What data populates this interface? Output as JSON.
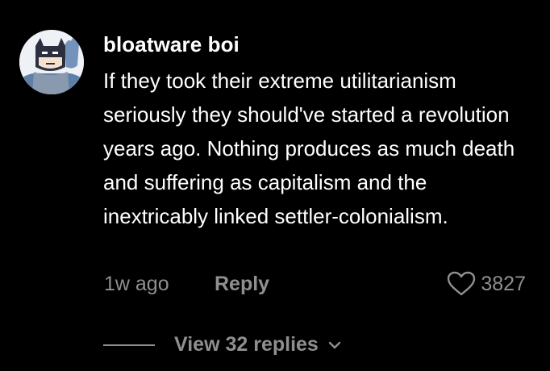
{
  "comment": {
    "username": "bloatware boi",
    "text": "If they took their extreme utilitarianism seriously they should've started a revolution years ago. Nothing produces as much death and suffering as capitalism and the inextricably linked settler-colonialism.",
    "time": "1w ago",
    "reply_label": "Reply",
    "like_count": "3827",
    "view_replies_label": "View 32 replies",
    "avatar_icon": "batman-cartoon-avatar",
    "like_icon": "heart-outline-icon",
    "expand_icon": "chevron-down-icon"
  },
  "colors": {
    "background": "#000000",
    "primary_text": "#ffffff",
    "secondary_text": "#8f8f8f"
  }
}
